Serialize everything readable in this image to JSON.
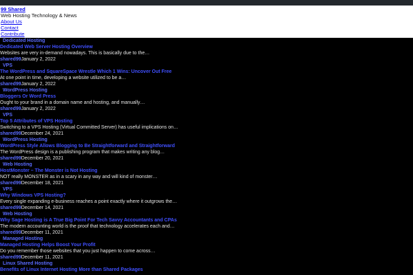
{
  "site": {
    "title": "99 Shared",
    "tagline": "Web Hosting Technology & News"
  },
  "nav": [
    {
      "label": "About Us"
    },
    {
      "label": "Contact"
    },
    {
      "label": "Contribute"
    }
  ],
  "posts": [
    {
      "category": "Dedicated Hosting",
      "title": "Dedicated Web Server Hosting Overview",
      "excerpt": "Websites are very in-demand nowadays. This is basically due to the…",
      "author": "shared99",
      "date": "January 2, 2022"
    },
    {
      "category": "VPS",
      "title": "The WordPress and SquareSpace Wrestle Which 1 Wins: Uncover Out Free",
      "excerpt": "At one point in time, developing a website utilized to be a…",
      "author": "shared99",
      "date": "January 2, 2022"
    },
    {
      "category": "WordPress Hosting",
      "title": "Bloggers Or Word Press",
      "excerpt": "Ought to your brand in a domain name and hosting, and manually…",
      "author": "shared99",
      "date": "January 2, 2022"
    },
    {
      "category": "VPS",
      "title": "Top 5 Attributes of VPS Hosting",
      "excerpt": "Switching to a VPS Hosting (Virtual Committed Server) has useful implications on…",
      "author": "shared99",
      "date": "December 24, 2021"
    },
    {
      "category": "WordPress Hosting",
      "title": "WordPress Style Allows Blogging to Be Straightforward and Straightforward",
      "excerpt": "The WordPress design is a publishing program that makes writing any blog…",
      "author": "shared99",
      "date": "December 20, 2021"
    },
    {
      "category": "Web Hosting",
      "title": "HostMonster – The Monster is Not Hosting",
      "excerpt": "NOT really MONSTER as in a scary in any way and will kind of monster…",
      "author": "shared99",
      "date": "December 18, 2021"
    },
    {
      "category": "VPS",
      "title": "Why Windows VPS Hosting?",
      "excerpt": "Every single expanding e-business reaches a point exactly where it outgrows the…",
      "author": "shared99",
      "date": "December 14, 2021"
    },
    {
      "category": "Web Hosting",
      "title": "Why Sage Hosting is A True Big Point For Tech Savvy Accountants and CPAs",
      "excerpt": "The modern accounting world is the proof that technology accelerates each and…",
      "author": "shared99",
      "date": "December 11, 2021"
    },
    {
      "category": "Managed Hosting",
      "title": "Managed Hosting Helps Boost Your Profit",
      "excerpt": "Do you remember those websites that you just happen to come across…",
      "author": "shared99",
      "date": "December 11, 2021"
    },
    {
      "category": "Linux Shared Hosting",
      "title": "Benefits of Linux Internet Hosting More than Shared Packages",
      "excerpt": "",
      "author": "",
      "date": ""
    }
  ],
  "colors": {
    "background": "#000000",
    "header_bg": "#ffffff",
    "link": "#0000ee",
    "post_title": "#4050ff"
  }
}
